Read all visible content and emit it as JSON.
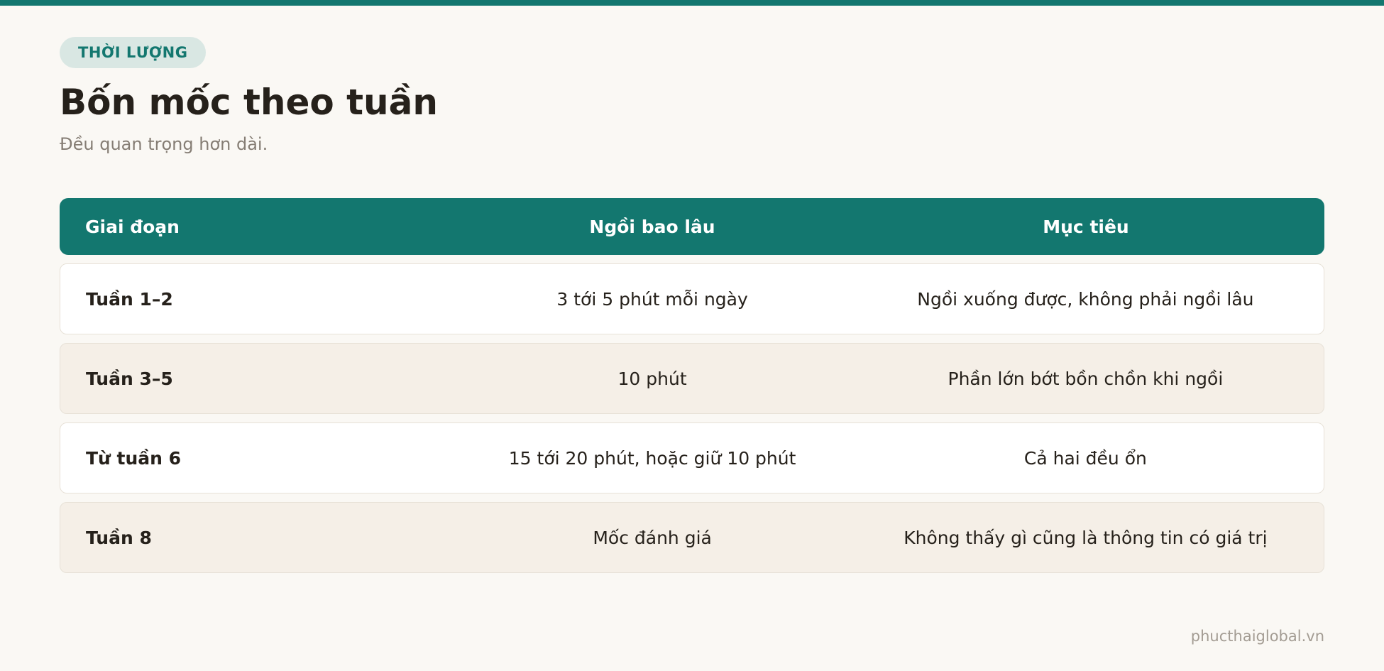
{
  "tag": "THỜI LƯỢNG",
  "title": "Bốn mốc theo tuần",
  "subtitle": "Đều quan trọng hơn dài.",
  "table": {
    "headers": [
      "Giai đoạn",
      "Ngồi bao lâu",
      "Mục tiêu"
    ],
    "rows": [
      [
        "Tuần 1–2",
        "3 tới 5 phút mỗi ngày",
        "Ngồi xuống được, không phải ngồi lâu"
      ],
      [
        "Tuần 3–5",
        "10 phút",
        "Phần lớn bớt bồn chồn khi ngồi"
      ],
      [
        "Từ tuần 6",
        "15 tới 20 phút, hoặc giữ 10 phút",
        "Cả hai đều ổn"
      ],
      [
        "Tuần 8",
        "Mốc đánh giá",
        "Không thấy gì cũng là thông tin có giá trị"
      ]
    ]
  },
  "footer": "phucthaiglobal.vn",
  "colors": {
    "accent": "#13776f",
    "background": "#faf8f4",
    "row_alt": "#f5efe7"
  }
}
